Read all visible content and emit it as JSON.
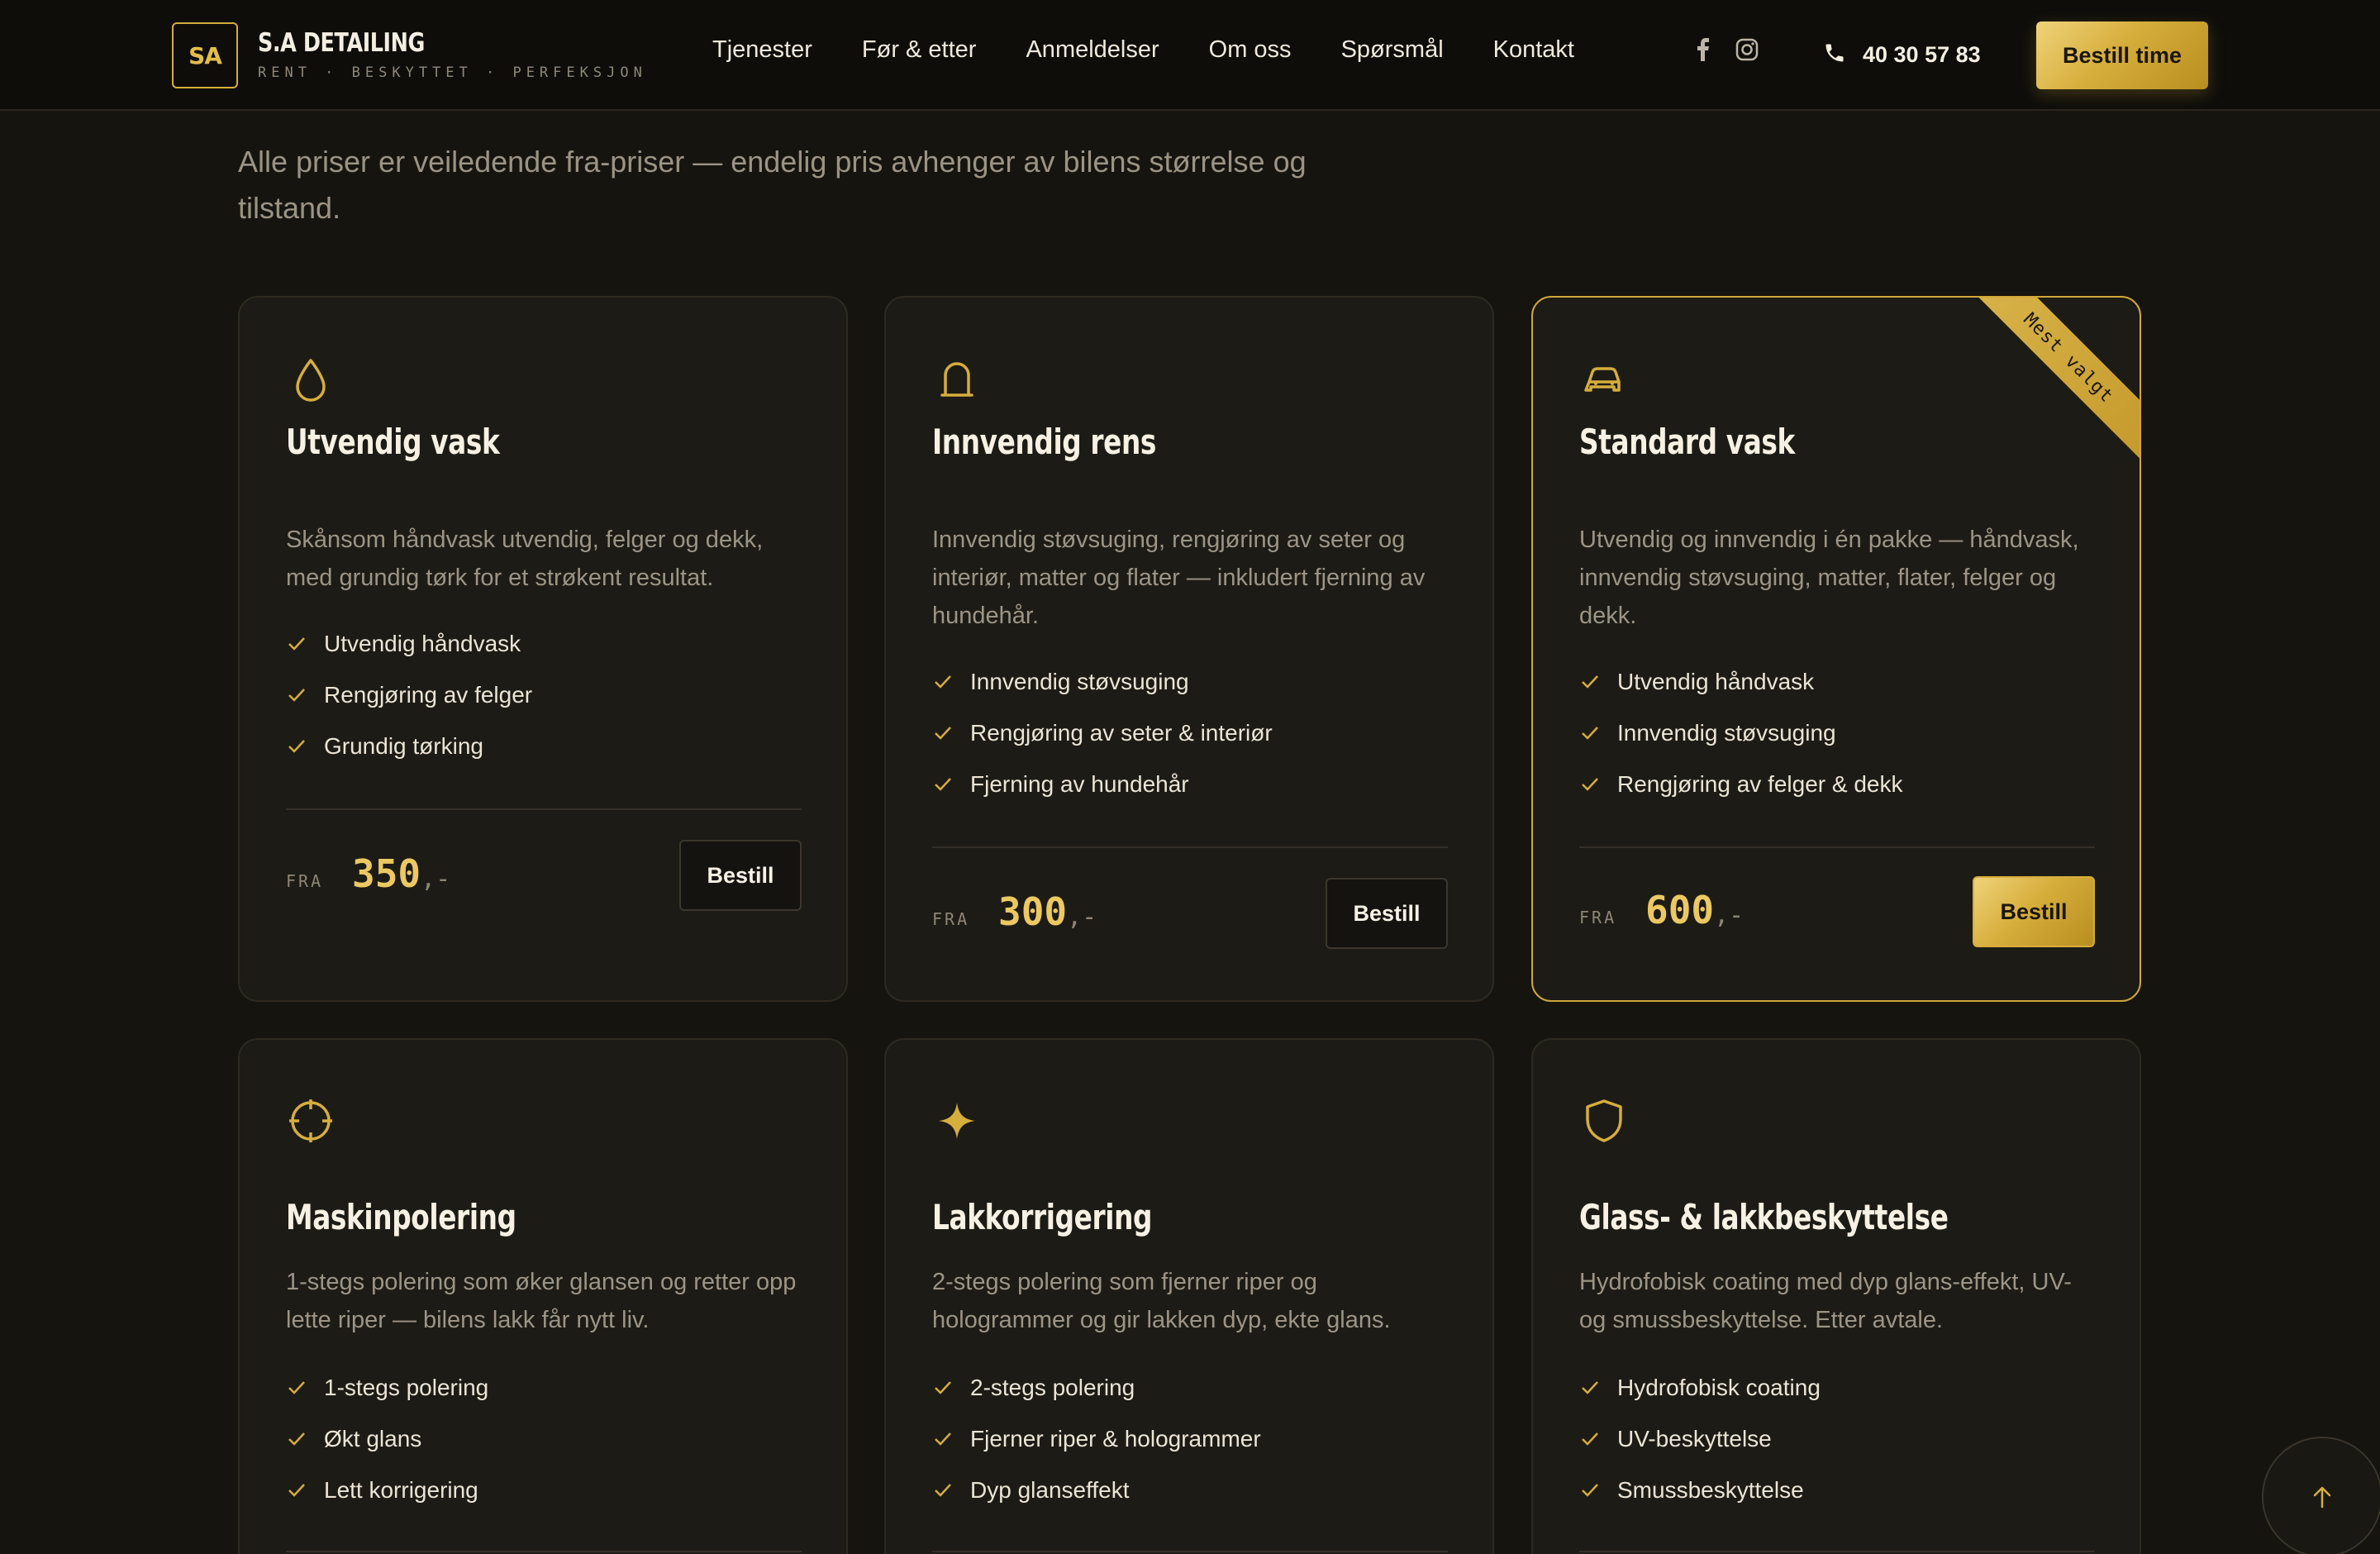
{
  "header": {
    "logo_mark": "SA",
    "brand_name": "S.A DETAILING",
    "brand_tagline": "RENT · BESKYTTET · PERFEKSJON",
    "nav": [
      "Tjenester",
      "Før & etter",
      "Anmeldelser",
      "Om oss",
      "Spørsmål",
      "Kontakt"
    ],
    "social_icons": [
      "facebook-icon",
      "instagram-icon"
    ],
    "phone": "40 30 57 83",
    "cta": "Bestill time"
  },
  "intro": "Alle priser er veiledende fra-priser — endelig pris avhenger av bilens størrelse og tilstand.",
  "price_prefix": "FRA",
  "price_suffix": ",-",
  "order_label": "Bestill",
  "cards": [
    {
      "icon": "drop-icon",
      "title": "Utvendig vask",
      "desc": "Skånsom håndvask utvendig, felger og dekk, med grundig tørk for et strøkent resultat.",
      "features": [
        "Utvendig håndvask",
        "Rengjøring av felger",
        "Grundig tørking"
      ],
      "price": "350",
      "featured": false
    },
    {
      "icon": "arch-icon",
      "title": "Innvendig rens",
      "desc": "Innvendig støvsuging, rengjøring av seter og interiør, matter og flater — inkludert fjerning av hundehår.",
      "features": [
        "Innvendig støvsuging",
        "Rengjøring av seter & interiør",
        "Fjerning av hundehår"
      ],
      "price": "300",
      "featured": false
    },
    {
      "icon": "car-icon",
      "title": "Standard vask",
      "desc": "Utvendig og innvendig i én pakke — håndvask, innvendig støvsuging, matter, flater, felger og dekk.",
      "features": [
        "Utvendig håndvask",
        "Innvendig støvsuging",
        "Rengjøring av felger & dekk"
      ],
      "price": "600",
      "featured": true,
      "ribbon": "Mest valgt"
    },
    {
      "icon": "crosshair-icon",
      "title": "Maskinpolering",
      "desc": "1-stegs polering som øker glansen og retter opp lette riper — bilens lakk får nytt liv.",
      "features": [
        "1-stegs polering",
        "Økt glans",
        "Lett korrigering"
      ],
      "featured": false
    },
    {
      "icon": "sparkle-icon",
      "title": "Lakkorrigering",
      "desc": "2-stegs polering som fjerner riper og hologrammer og gir lakken dyp, ekte glans.",
      "features": [
        "2-stegs polering",
        "Fjerner riper & hologrammer",
        "Dyp glanseffekt"
      ],
      "featured": false
    },
    {
      "icon": "shield-icon",
      "title": "Glass- & lakkbeskyttelse",
      "desc": "Hydrofobisk coating med dyp glans-effekt, UV- og smussbeskyttelse. Etter avtale.",
      "features": [
        "Hydrofobisk coating",
        "UV-beskyttelse",
        "Smussbeskyttelse"
      ],
      "featured": false
    }
  ],
  "colors": {
    "background": "#16140f",
    "card": "#1d1b15",
    "gold": "#d6ae3c",
    "price": "#ecc862"
  },
  "scroll_top_icon": "arrow-up-icon"
}
